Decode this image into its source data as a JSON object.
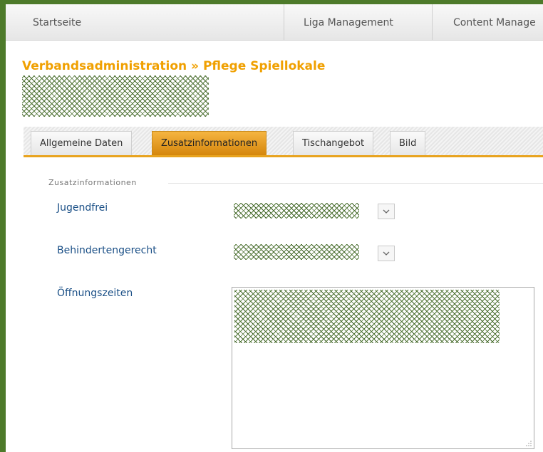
{
  "nav": {
    "items": [
      "Startseite",
      "Liga Management",
      "Content Manage"
    ]
  },
  "page": {
    "heading": "Verbandsadministration » Pflege Spiellokale"
  },
  "tabs": [
    {
      "label": "Allgemeine Daten",
      "active": false
    },
    {
      "label": "Zusatzinformationen",
      "active": true
    },
    {
      "label": "Tischangebot",
      "active": false
    },
    {
      "label": "Bild",
      "active": false
    }
  ],
  "form": {
    "legend": "Zusatzinformationen",
    "fields": [
      {
        "label": "Jugendfrei"
      },
      {
        "label": "Behindertengerecht"
      },
      {
        "label": "Öffnungszeiten"
      }
    ]
  },
  "colors": {
    "accent": "#f0a000",
    "frame": "#4d7a2a",
    "label": "#1a4f86"
  },
  "icons": [
    "chevron-down-icon",
    "resize-grip-icon"
  ]
}
